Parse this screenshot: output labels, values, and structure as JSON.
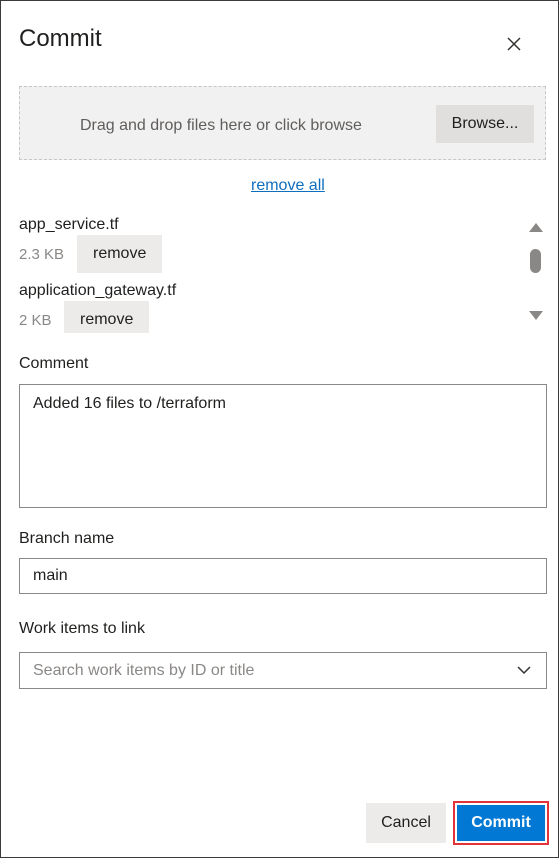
{
  "dialog": {
    "title": "Commit",
    "close_icon": "close-icon"
  },
  "dropzone": {
    "text": "Drag and drop files here or click browse",
    "browse_label": "Browse..."
  },
  "remove_all_label": "remove all",
  "files": [
    {
      "name": "app_service.tf",
      "size": "2.3 KB",
      "remove_label": "remove"
    },
    {
      "name": "application_gateway.tf",
      "size": "2 KB",
      "remove_label": "remove"
    }
  ],
  "comment": {
    "label": "Comment",
    "value": "Added 16 files to /terraform"
  },
  "branch": {
    "label": "Branch name",
    "value": "main"
  },
  "work_items": {
    "label": "Work items to link",
    "placeholder": "Search work items by ID or title"
  },
  "actions": {
    "cancel_label": "Cancel",
    "commit_label": "Commit"
  },
  "colors": {
    "primary": "#0078d4",
    "highlight_border": "#e0343a",
    "link": "#106ebe"
  }
}
